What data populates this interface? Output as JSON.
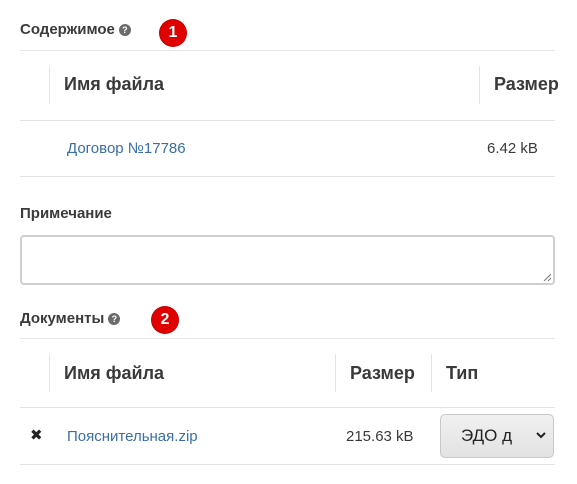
{
  "content_section": {
    "title": "Содержимое",
    "help_icon": "question-circle-icon",
    "badge": "1",
    "columns": [
      "Имя файла",
      "Размер"
    ],
    "rows": [
      {
        "name": "Договор №17786",
        "size": "6.42 kB"
      }
    ]
  },
  "note_section": {
    "label": "Примечание",
    "value": "",
    "resize_icon": "resize-grip-icon"
  },
  "documents_section": {
    "title": "Документы",
    "help_icon": "question-circle-icon",
    "badge": "2",
    "columns": [
      "Имя файла",
      "Размер",
      "Тип"
    ],
    "rows": [
      {
        "remove_icon": "close-icon",
        "name": "Пояснительная.zip",
        "size": "215.63 kB",
        "type": "ЭДО документ",
        "type_visible": "ЭДО д"
      }
    ]
  },
  "colors": {
    "badge": "#e00000",
    "link": "#3a6ea5",
    "border": "#e4e4e4"
  }
}
